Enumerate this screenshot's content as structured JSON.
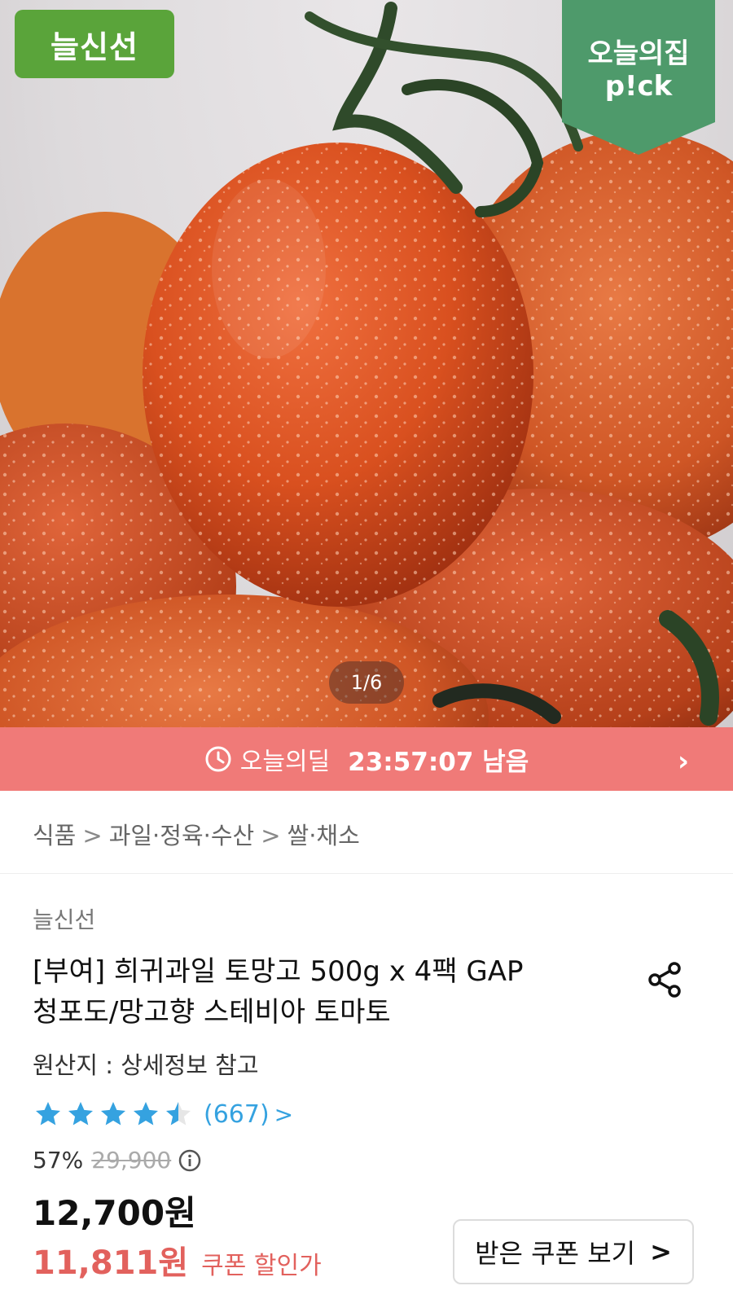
{
  "hero": {
    "brand_badge": "늘신선",
    "pick_badge_line1": "오늘의집",
    "pick_badge_line2": "p!ck",
    "image_counter": "1/6",
    "image_icon": "tomato-product-photo"
  },
  "deal_bar": {
    "icon": "clock-icon",
    "label": "오늘의딜",
    "time_left": "23:57:07 남음",
    "chevron": "›"
  },
  "breadcrumb": {
    "items": [
      "식품",
      "과일·정육·수산",
      "쌀·채소"
    ],
    "separator": ">"
  },
  "product": {
    "brand": "늘신선",
    "title_line1": "[부여] 희귀과일 토망고 500g x 4팩 GAP",
    "title_line2": "청포도/망고향 스테비아 토마토",
    "origin": "원산지 : 상세정보 참고",
    "rating_value": 4.5,
    "rating_max": 5,
    "review_count": "(667)",
    "review_chevron": ">",
    "discount_percent": "57%",
    "original_price": "29,900",
    "price": "12,700원",
    "coupon_price": "11,811원",
    "coupon_price_label": "쿠폰 할인가",
    "coupon_button_label": "받은 쿠폰 보기",
    "coupon_button_chevron": ">"
  },
  "colors": {
    "brand_green": "#5aa43a",
    "pick_green": "#4e9a6b",
    "deal_bar": "#f07a78",
    "star_blue": "#35a2e0",
    "coupon_red": "#e2615d"
  }
}
